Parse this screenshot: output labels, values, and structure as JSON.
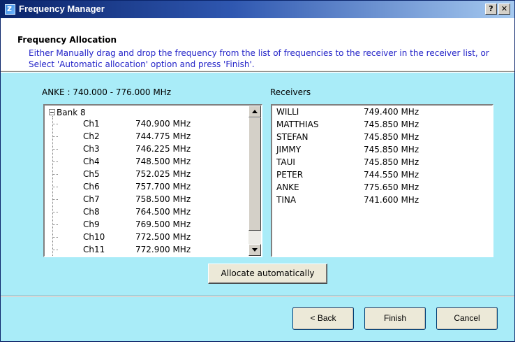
{
  "window": {
    "title": "Frequency Manager",
    "help_label": "?",
    "close_label": "✕"
  },
  "header": {
    "title": "Frequency Allocation",
    "description": "Either Manually drag and drop the frequency from the list of frequencies to the receiver in the receiver list, or Select 'Automatic allocation' option and press 'Finish'."
  },
  "frequency_list": {
    "label": "ANKE : 740.000 - 776.000 MHz",
    "bank": "Bank 8",
    "channels": [
      {
        "ch": "Ch1",
        "freq": "740.900  MHz"
      },
      {
        "ch": "Ch2",
        "freq": "744.775  MHz"
      },
      {
        "ch": "Ch3",
        "freq": "746.225  MHz"
      },
      {
        "ch": "Ch4",
        "freq": "748.500  MHz"
      },
      {
        "ch": "Ch5",
        "freq": "752.025  MHz"
      },
      {
        "ch": "Ch6",
        "freq": "757.700  MHz"
      },
      {
        "ch": "Ch7",
        "freq": "758.500  MHz"
      },
      {
        "ch": "Ch8",
        "freq": "764.500  MHz"
      },
      {
        "ch": "Ch9",
        "freq": "769.500  MHz"
      },
      {
        "ch": "Ch10",
        "freq": "772.500  MHz"
      },
      {
        "ch": "Ch11",
        "freq": "772.900  MHz"
      }
    ]
  },
  "receivers": {
    "label": "Receivers",
    "items": [
      {
        "name": "WILLI",
        "freq": "749.400 MHz"
      },
      {
        "name": "MATTHIAS",
        "freq": "745.850 MHz"
      },
      {
        "name": "STEFAN",
        "freq": "745.850 MHz"
      },
      {
        "name": "JIMMY",
        "freq": "745.850 MHz"
      },
      {
        "name": "TAUI",
        "freq": "745.850 MHz"
      },
      {
        "name": "PETER",
        "freq": "744.550 MHz"
      },
      {
        "name": "ANKE",
        "freq": "775.650 MHz"
      },
      {
        "name": "TINA",
        "freq": "741.600 MHz"
      }
    ]
  },
  "allocate_button": "Allocate automatically",
  "footer": {
    "back": "< Back",
    "finish": "Finish",
    "cancel": "Cancel"
  },
  "colors": {
    "panel_bg": "#a9ecf8",
    "header_desc": "#2323c8",
    "titlebar_start": "#0a246a",
    "titlebar_end": "#a6caf0"
  }
}
